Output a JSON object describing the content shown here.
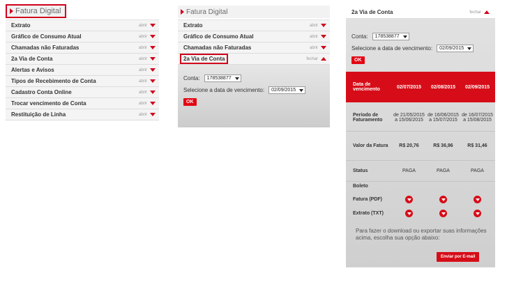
{
  "p1": {
    "title": "Fatura Digital",
    "items": [
      {
        "label": "Extrato",
        "action": "abrir"
      },
      {
        "label": "Gráfico de Consumo Atual",
        "action": "abrir"
      },
      {
        "label": "Chamadas não Faturadas",
        "action": "abrir"
      },
      {
        "label": "2a Via de Conta",
        "action": "abrir"
      },
      {
        "label": "Alertas e Avisos",
        "action": "abrir"
      },
      {
        "label": "Tipos de Recebimento de Conta",
        "action": "abrir"
      },
      {
        "label": "Cadastro Conta Online",
        "action": "abrir"
      },
      {
        "label": "Trocar vencimento de Conta",
        "action": "abrir"
      },
      {
        "label": "Restituição de Linha",
        "action": "abrir"
      }
    ]
  },
  "p2": {
    "title": "Fatura Digital",
    "items": [
      {
        "label": "Extrato",
        "action": "abrir"
      },
      {
        "label": "Gráfico de Consumo Atual",
        "action": "abrir"
      },
      {
        "label": "Chamadas não Faturadas",
        "action": "abrir"
      },
      {
        "label": "2a Via de Conta",
        "action": "fechar"
      }
    ],
    "conta_label": "Conta:",
    "conta_value": "178538877",
    "date_label": "Selecione a data de vencimento:",
    "date_value": "02/09/2015",
    "ok_label": "OK"
  },
  "p3": {
    "title": "2a Via de Conta",
    "action": "fechar",
    "conta_label": "Conta:",
    "conta_value": "178538877",
    "date_label": "Selecione a data de vencimento:",
    "date_value": "02/09/2015",
    "ok_label": "OK",
    "header_label": "Data de vencimento",
    "dates": [
      "02/07/2015",
      "02/08/2015",
      "02/09/2015"
    ],
    "periodo_label": "Período de Faturamento",
    "periodos": [
      "de 21/05/2015 a 15/06/2015",
      "de 16/06/2015 a 15/07/2015",
      "de 16/07/2015 a 15/08/2015"
    ],
    "valor_label": "Valor da Fatura",
    "valores": [
      "R$ 20,76",
      "R$ 36,96",
      "R$ 31,46"
    ],
    "status_label": "Status",
    "statuses": [
      "PAGA",
      "PAGA",
      "PAGA"
    ],
    "boleto_label": "Boleto",
    "fatura_label": "Fatura (PDF)",
    "extrato_label": "Extrato (TXT)",
    "note": "Para fazer o download ou exportar suas informações acima, escolha sua opção abaixo:",
    "email_label": "Enviar por E-mail"
  },
  "colors": {
    "accent": "#d60d18",
    "panel_gray": "#d6d6d6"
  }
}
